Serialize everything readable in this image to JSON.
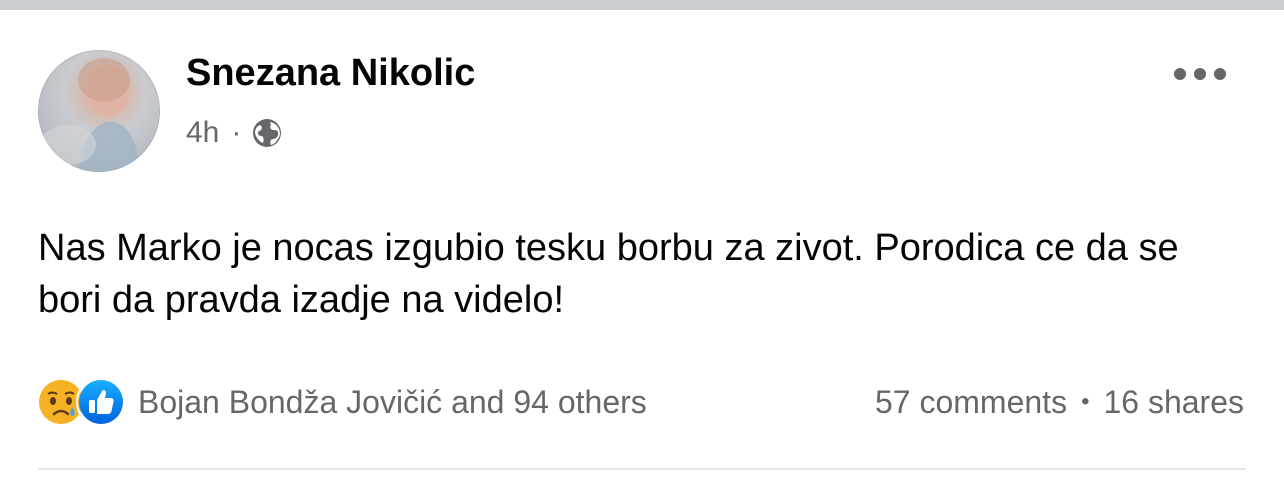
{
  "post": {
    "author": "Snezana Nikolic",
    "time": "4h",
    "separator": "·",
    "privacy_icon": "globe-icon",
    "more_icon": "more-horizontal-icon",
    "text": "Nas Marko je nocas izgubio tesku borbu za zivot. Porodica ce da se bori da pravda izadje na videlo!"
  },
  "reactions": {
    "icons": [
      "sad-reaction-icon",
      "like-reaction-icon"
    ],
    "summary": "Bojan Bondža Jovičić and 94 others"
  },
  "counts": {
    "comments": "57 comments",
    "dot": "•",
    "shares": "16 shares"
  },
  "colors": {
    "text_primary": "#050505",
    "text_secondary": "#65676b",
    "like_blue": "#1877f2",
    "sad_yellow": "#f7b125",
    "top_bar": "#c9ccd1",
    "divider": "#e4e6eb"
  }
}
